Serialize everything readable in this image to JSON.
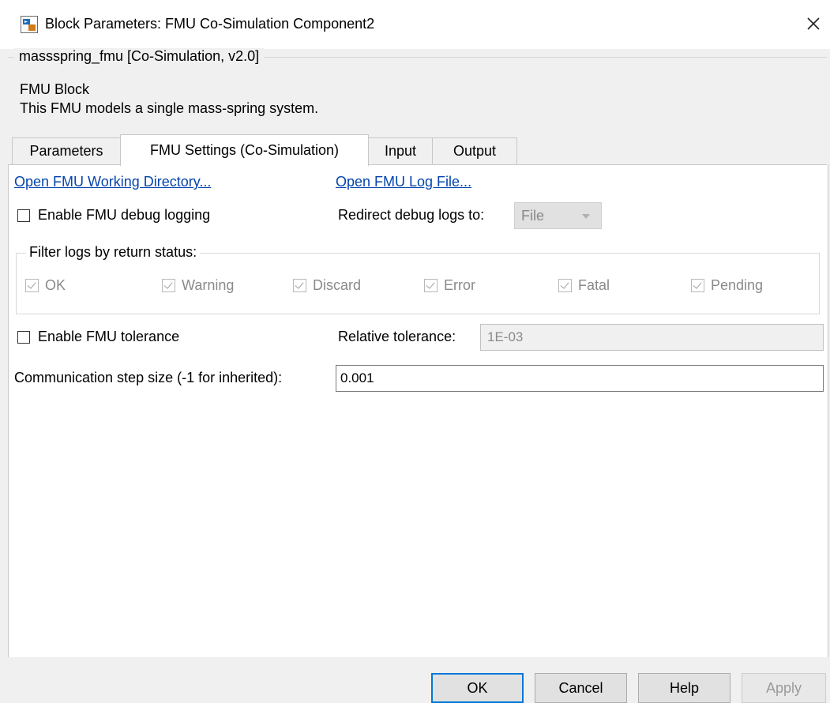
{
  "window": {
    "title": "Block Parameters: FMU Co-Simulation Component2"
  },
  "description": {
    "legend": "massspring_fmu [Co-Simulation, v2.0]",
    "title": "FMU Block",
    "text": "This FMU models a single mass-spring system."
  },
  "tabs": [
    {
      "label": "Parameters",
      "active": false
    },
    {
      "label": "FMU Settings (Co-Simulation)",
      "active": true
    },
    {
      "label": "Input",
      "active": false
    },
    {
      "label": "Output",
      "active": false
    }
  ],
  "settings": {
    "open_dir_link": "Open FMU Working Directory...",
    "open_log_link": "Open FMU Log File...",
    "debug_logging_label": "Enable FMU debug logging",
    "debug_logging_checked": false,
    "redirect_label": "Redirect debug logs to:",
    "redirect_value": "File",
    "filter_legend": "Filter logs by return status:",
    "statuses": [
      {
        "label": "OK",
        "checked": true
      },
      {
        "label": "Warning",
        "checked": true
      },
      {
        "label": "Discard",
        "checked": true
      },
      {
        "label": "Error",
        "checked": true
      },
      {
        "label": "Fatal",
        "checked": true
      },
      {
        "label": "Pending",
        "checked": true
      }
    ],
    "tolerance_label": "Enable FMU tolerance",
    "tolerance_checked": false,
    "rel_tol_label": "Relative tolerance:",
    "rel_tol_value": "1E-03",
    "step_label": "Communication step size (-1 for inherited):",
    "step_value": "0.001"
  },
  "buttons": {
    "ok": "OK",
    "cancel": "Cancel",
    "help": "Help",
    "apply": "Apply"
  }
}
